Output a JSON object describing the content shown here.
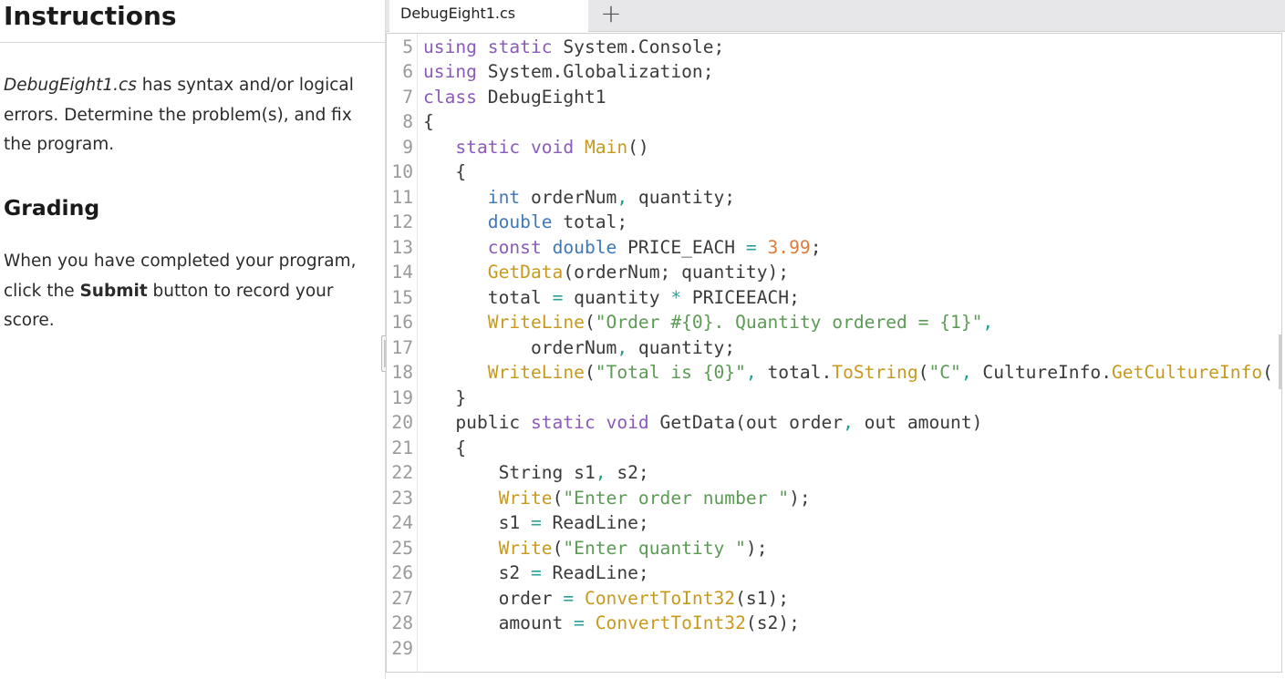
{
  "instructions": {
    "title": "Instructions",
    "file_name": "DebugEight1.cs",
    "p1_rest": " has syntax and/or logical errors. Determine the problem(s), and fix the program.",
    "grading_title": "Grading",
    "p2_pre": "When you have completed your program, click the ",
    "p2_bold": "Submit",
    "p2_post": " button to record your score."
  },
  "tabs": [
    {
      "label": "DebugEight1.cs",
      "active": true
    }
  ],
  "add_tab_label": "+",
  "editor": {
    "lines": [
      {
        "n": "5",
        "tokens": [
          [
            "kw",
            "using"
          ],
          [
            "t",
            " "
          ],
          [
            "kw",
            "static"
          ],
          [
            "t",
            " System.Console;"
          ]
        ]
      },
      {
        "n": "6",
        "tokens": [
          [
            "kw",
            "using"
          ],
          [
            "t",
            " System.Globalization;"
          ]
        ]
      },
      {
        "n": "7",
        "tokens": [
          [
            "kw",
            "class"
          ],
          [
            "t",
            " DebugEight1"
          ]
        ]
      },
      {
        "n": "8",
        "tokens": [
          [
            "t",
            "{"
          ]
        ]
      },
      {
        "n": "9",
        "tokens": [
          [
            "t",
            "   "
          ],
          [
            "kw",
            "static"
          ],
          [
            "t",
            " "
          ],
          [
            "kw",
            "void"
          ],
          [
            "t",
            " "
          ],
          [
            "fn",
            "Main"
          ],
          [
            "t",
            "()"
          ]
        ]
      },
      {
        "n": "10",
        "tokens": [
          [
            "t",
            "   {"
          ]
        ]
      },
      {
        "n": "11",
        "tokens": [
          [
            "t",
            "      "
          ],
          [
            "ty",
            "int"
          ],
          [
            "t",
            " orderNum"
          ],
          [
            "pu",
            ","
          ],
          [
            "t",
            " quantity;"
          ]
        ]
      },
      {
        "n": "12",
        "tokens": [
          [
            "t",
            "      "
          ],
          [
            "ty",
            "double"
          ],
          [
            "t",
            " total;"
          ]
        ]
      },
      {
        "n": "13",
        "tokens": [
          [
            "t",
            "      "
          ],
          [
            "kw",
            "const"
          ],
          [
            "t",
            " "
          ],
          [
            "ty",
            "double"
          ],
          [
            "t",
            " PRICE_EACH "
          ],
          [
            "op",
            "="
          ],
          [
            "t",
            " "
          ],
          [
            "nm",
            "3.99"
          ],
          [
            "t",
            ";"
          ]
        ]
      },
      {
        "n": "14",
        "tokens": [
          [
            "t",
            "      "
          ],
          [
            "fn",
            "GetData"
          ],
          [
            "t",
            "(orderNum; quantity);"
          ]
        ]
      },
      {
        "n": "15",
        "tokens": [
          [
            "t",
            "      total "
          ],
          [
            "op",
            "="
          ],
          [
            "t",
            " quantity "
          ],
          [
            "op",
            "*"
          ],
          [
            "t",
            " PRICEEACH;"
          ]
        ]
      },
      {
        "n": "16",
        "tokens": [
          [
            "t",
            "      "
          ],
          [
            "fn",
            "WriteLine"
          ],
          [
            "t",
            "("
          ],
          [
            "st",
            "\"Order #{0}. Quantity ordered = {1}\""
          ],
          [
            "pu",
            ","
          ]
        ]
      },
      {
        "n": "17",
        "tokens": [
          [
            "t",
            "          orderNum"
          ],
          [
            "pu",
            ","
          ],
          [
            "t",
            " quantity;"
          ]
        ]
      },
      {
        "n": "18",
        "tokens": [
          [
            "t",
            "      "
          ],
          [
            "fn",
            "WriteLine"
          ],
          [
            "t",
            "("
          ],
          [
            "st",
            "\"Total is {0}\""
          ],
          [
            "pu",
            ","
          ],
          [
            "t",
            " total."
          ],
          [
            "fn",
            "ToString"
          ],
          [
            "t",
            "("
          ],
          [
            "st",
            "\"C\""
          ],
          [
            "pu",
            ","
          ],
          [
            "t",
            " CultureInfo."
          ],
          [
            "fn",
            "GetCultureInfo"
          ],
          [
            "t",
            "("
          ]
        ]
      },
      {
        "n": "19",
        "tokens": [
          [
            "t",
            "   }"
          ]
        ]
      },
      {
        "n": "20",
        "tokens": [
          [
            "t",
            "   "
          ],
          [
            "t",
            "public"
          ],
          [
            "t",
            " "
          ],
          [
            "kw",
            "static"
          ],
          [
            "t",
            " "
          ],
          [
            "kw",
            "void"
          ],
          [
            "t",
            " GetData(out order"
          ],
          [
            "pu",
            ","
          ],
          [
            "t",
            " out amount)"
          ]
        ]
      },
      {
        "n": "21",
        "tokens": [
          [
            "t",
            "   {"
          ]
        ]
      },
      {
        "n": "22",
        "tokens": [
          [
            "t",
            "       String s1"
          ],
          [
            "pu",
            ","
          ],
          [
            "t",
            " s2;"
          ]
        ]
      },
      {
        "n": "23",
        "tokens": [
          [
            "t",
            "       "
          ],
          [
            "fn",
            "Write"
          ],
          [
            "t",
            "("
          ],
          [
            "st",
            "\"Enter order number \""
          ],
          [
            "t",
            ");"
          ]
        ]
      },
      {
        "n": "24",
        "tokens": [
          [
            "t",
            "       s1 "
          ],
          [
            "op",
            "="
          ],
          [
            "t",
            " ReadLine;"
          ]
        ]
      },
      {
        "n": "25",
        "tokens": [
          [
            "t",
            "       "
          ],
          [
            "fn",
            "Write"
          ],
          [
            "t",
            "("
          ],
          [
            "st",
            "\"Enter quantity \""
          ],
          [
            "t",
            ");"
          ]
        ]
      },
      {
        "n": "26",
        "tokens": [
          [
            "t",
            "       s2 "
          ],
          [
            "op",
            "="
          ],
          [
            "t",
            " ReadLine;"
          ]
        ]
      },
      {
        "n": "27",
        "tokens": [
          [
            "t",
            "       order "
          ],
          [
            "op",
            "="
          ],
          [
            "t",
            " "
          ],
          [
            "fn",
            "ConvertToInt32"
          ],
          [
            "t",
            "(s1);"
          ]
        ]
      },
      {
        "n": "28",
        "tokens": [
          [
            "t",
            "       amount "
          ],
          [
            "op",
            "="
          ],
          [
            "t",
            " "
          ],
          [
            "fn",
            "ConvertToInt32"
          ],
          [
            "t",
            "(s2);"
          ]
        ]
      },
      {
        "n": "29",
        "tokens": []
      }
    ]
  }
}
